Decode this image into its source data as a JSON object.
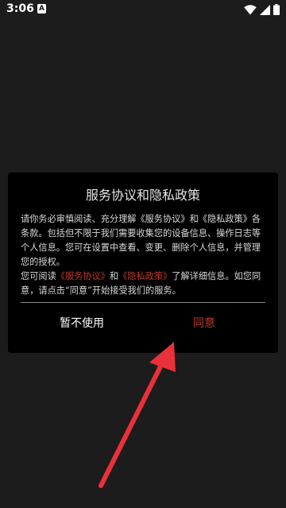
{
  "status_bar": {
    "time": "3:06",
    "notification_glyph": "A",
    "icons": [
      "wifi-icon",
      "cellular-signal-icon",
      "battery-icon"
    ]
  },
  "dialog": {
    "title": "服务协议和隐私政策",
    "body_part1": "请你务必审慎阅读、充分理解《服务协议》和《隐私政策》各条款。包括但不限于我们需要收集您的设备信息、操作日志等个人信息。您可在设置中查看、变更、删除个人信息，并管理您的授权。",
    "body_part2_prefix": "您可阅读",
    "service_agreement_link": "《服务协议》",
    "conjunction": "和",
    "privacy_policy_link": "《隐私政策》",
    "body_part2_suffix": "了解详细信息。如您同意，请点击“同意”开始接受我们的服务。",
    "decline_label": "暂不使用",
    "agree_label": "同意"
  },
  "colors": {
    "background": "#1c1c1c",
    "dialog_background": "#000000",
    "accent": "#c0392b",
    "arrow": "#e8313a"
  }
}
